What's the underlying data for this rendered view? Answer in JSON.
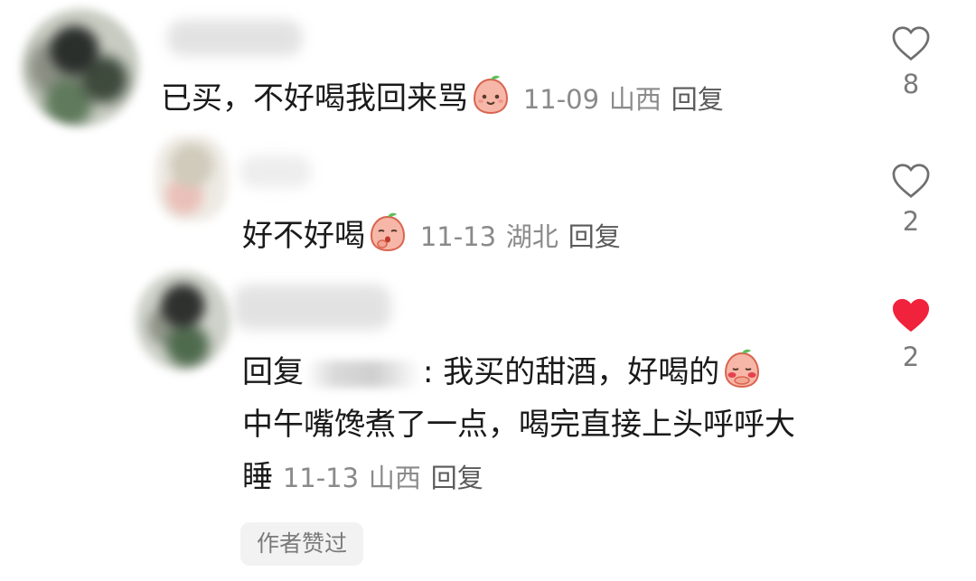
{
  "comments": {
    "main": {
      "text": "已买，不好喝我回来骂",
      "emoji": "smiling-peach-emoji",
      "date": "11-09",
      "location": "山西",
      "reply_label": "回复",
      "likes": "8",
      "liked": false
    },
    "reply1": {
      "text": "好不好喝",
      "emoji": "thinking-peach-emoji",
      "date": "11-13",
      "location": "湖北",
      "reply_label": "回复",
      "likes": "2",
      "liked": false
    },
    "reply2": {
      "prefix": "回复",
      "text": ": 我买的甜酒，好喝的",
      "emoji": "blushing-peach-emoji",
      "text2": "中午嘴馋煮了一点，喝完直接上头呼呼大睡",
      "date": "11-13",
      "location": "山西",
      "reply_label": "回复",
      "likes": "2",
      "liked": true,
      "author_liked_label": "作者赞过"
    }
  },
  "colors": {
    "like_active": "#f0223c",
    "like_inactive": "#7a7a7a"
  }
}
